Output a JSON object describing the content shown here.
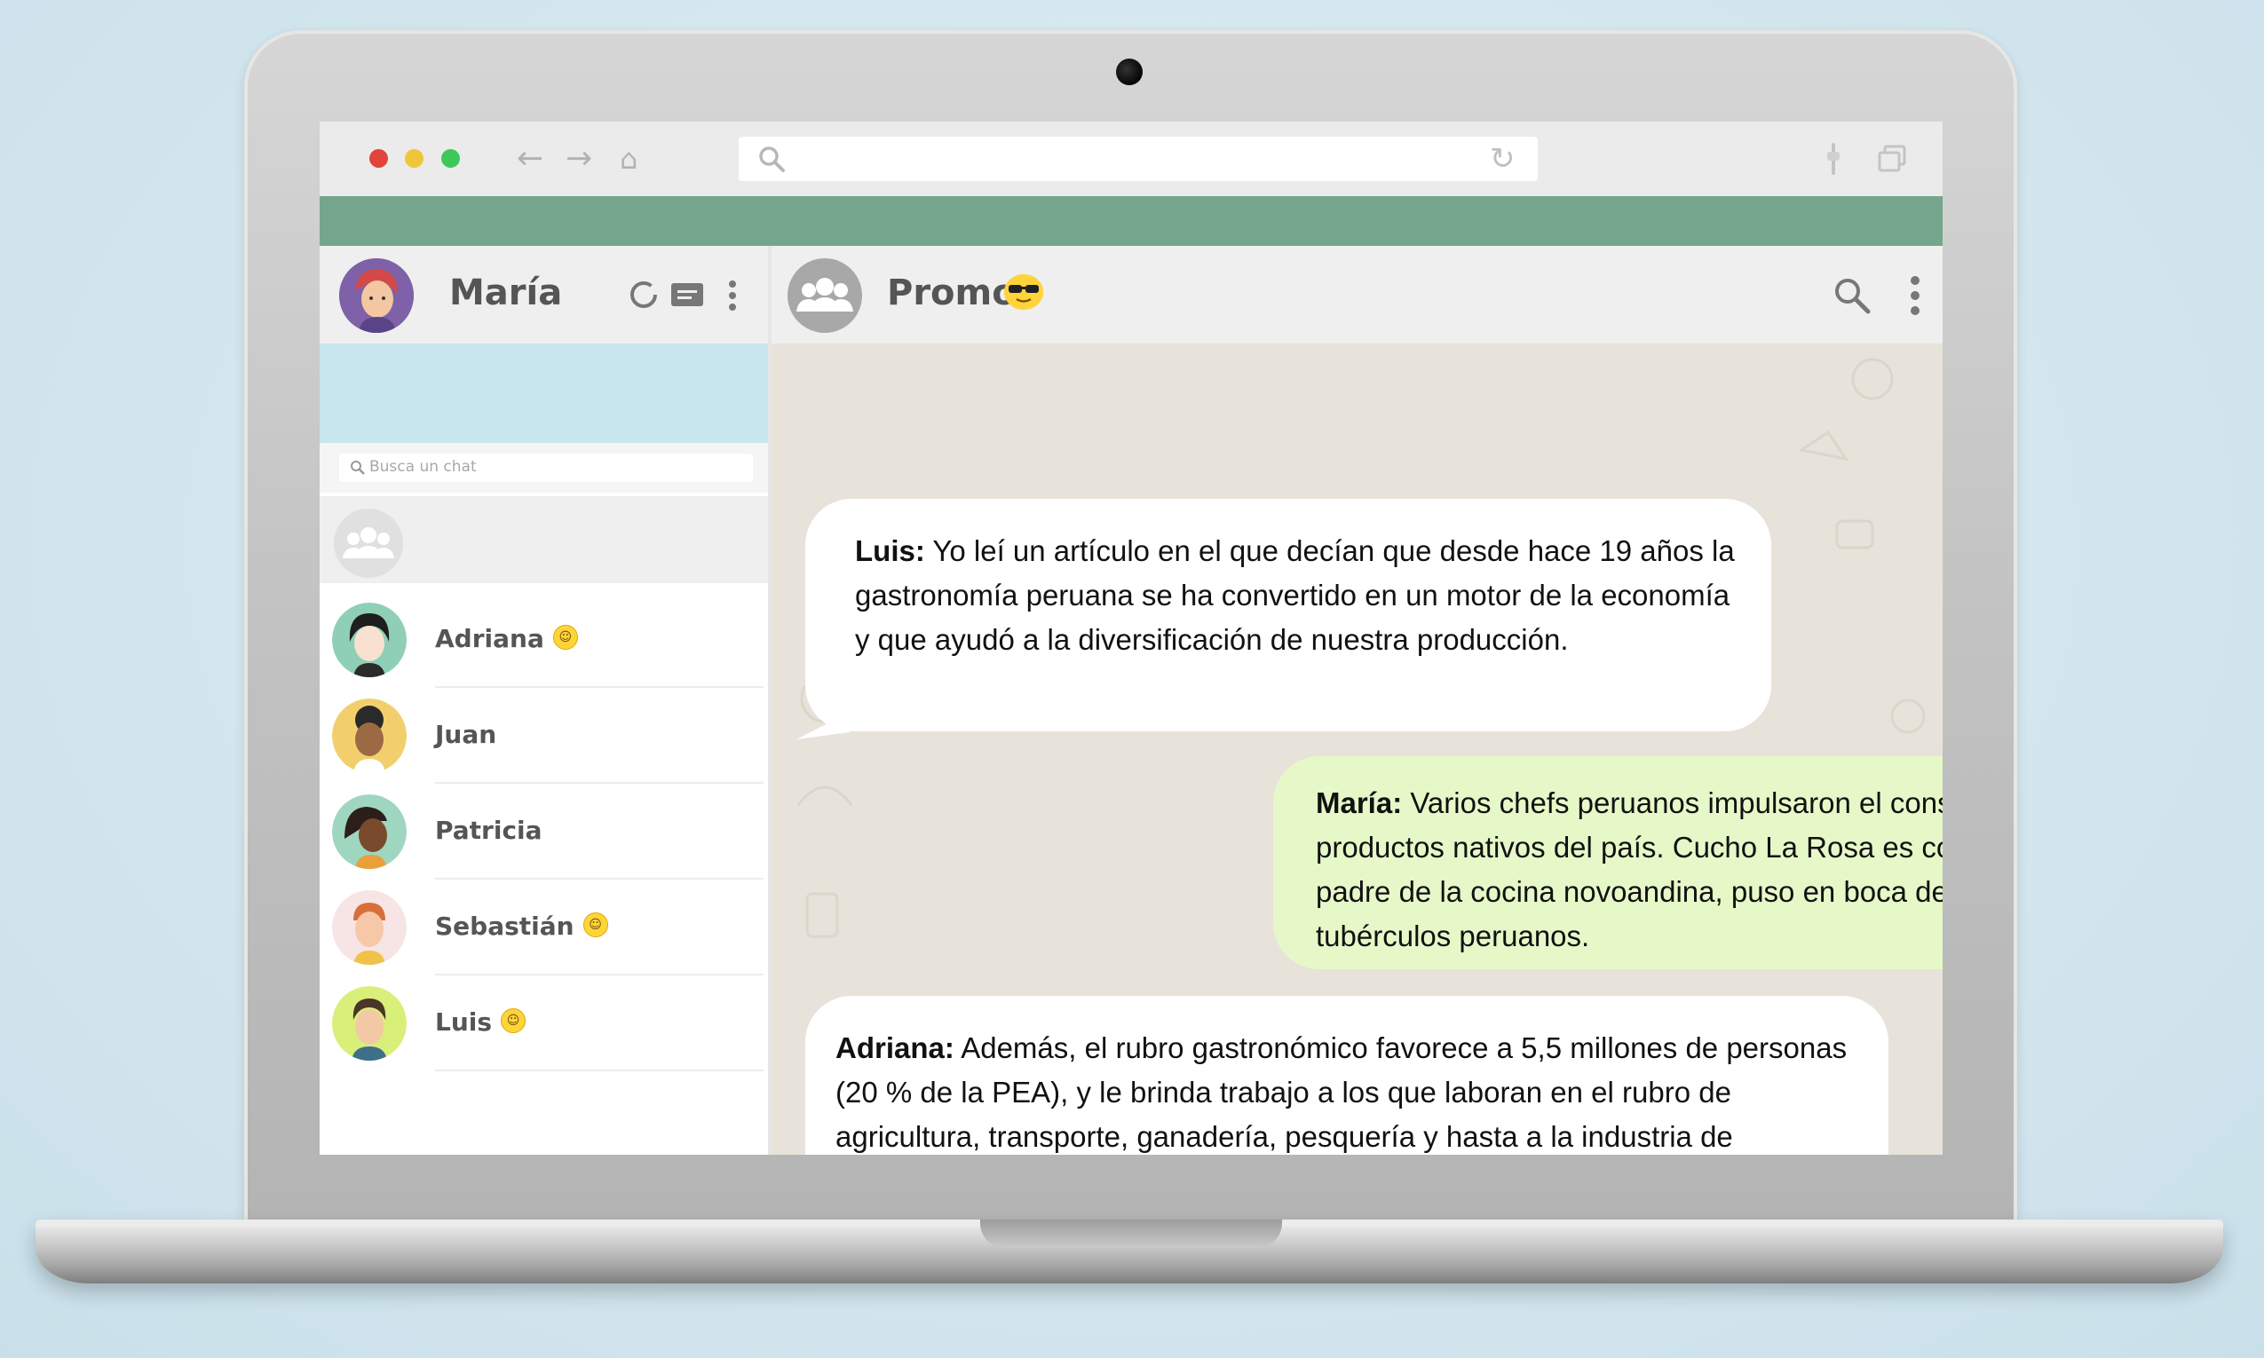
{
  "sidebar": {
    "user_name": "María",
    "search_placeholder": "Busca un chat",
    "chats": [
      {
        "name": "Adriana",
        "emoji": "☺"
      },
      {
        "name": "Juan",
        "emoji": ""
      },
      {
        "name": "Patricia",
        "emoji": ""
      },
      {
        "name": "Sebastián",
        "emoji": "☺"
      },
      {
        "name": "Luis",
        "emoji": "☺"
      }
    ]
  },
  "chat": {
    "group_name": "Promo",
    "messages": [
      {
        "sender": "Luis:",
        "text": " Yo leí un artículo en el que decían que desde hace 19 años la gastronomía peruana se ha convertido en un motor de la economía y que ayudó a la diversificación de nuestra producción."
      },
      {
        "sender": "María:",
        "text": " Varios chefs peruanos impulsaron el consumo de productos nativos del país. Cucho La Rosa es conocido como el padre de la cocina novoandina, puso en boca de todos la quinua y tubérculos peruanos."
      },
      {
        "sender": "Adriana:",
        "text": " Además, el rubro gastronómico favorece a 5,5 millones de personas (20 % de la PEA), y le brinda trabajo a los que laboran en el rubro de agricultura, transporte, ganadería, pesquería y hasta a la industria de productos alimenticios y manufacturera de menaje."
      }
    ]
  },
  "icons": {
    "status": "status-icon",
    "new_chat": "new-chat-icon",
    "menu": "menu-icon",
    "search": "search-icon"
  },
  "colors": {
    "accent_band": "#75a68c",
    "incoming_bubble": "#ffffff",
    "outgoing_bubble": "#e6f8c8",
    "chat_background": "#e7e3da"
  }
}
